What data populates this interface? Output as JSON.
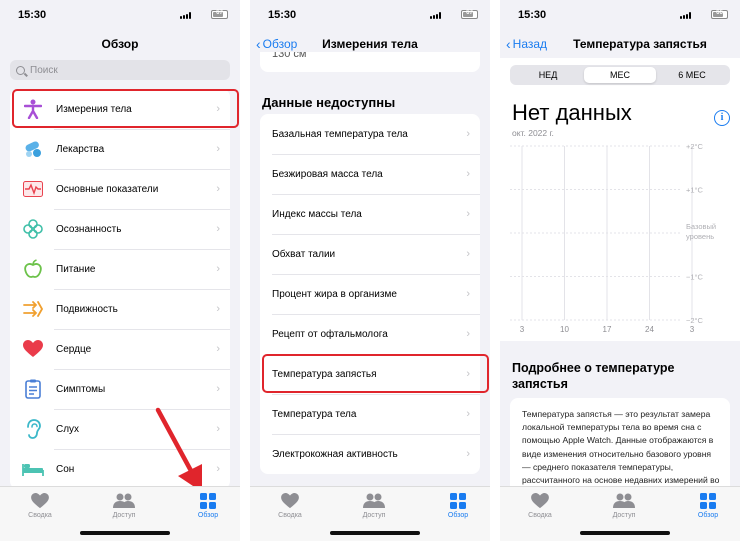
{
  "screens": [
    {
      "status": {
        "time": "15:30",
        "battery": "67"
      },
      "title": "Обзор",
      "search_placeholder": "Поиск",
      "items": [
        {
          "label": "Измерения тела",
          "icon": "body-measurements-icon"
        },
        {
          "label": "Лекарства",
          "icon": "medications-icon"
        },
        {
          "label": "Основные показатели",
          "icon": "vitals-icon"
        },
        {
          "label": "Осознанность",
          "icon": "mindfulness-icon"
        },
        {
          "label": "Питание",
          "icon": "nutrition-icon"
        },
        {
          "label": "Подвижность",
          "icon": "mobility-icon"
        },
        {
          "label": "Сердце",
          "icon": "heart-icon"
        },
        {
          "label": "Симптомы",
          "icon": "symptoms-icon"
        },
        {
          "label": "Слух",
          "icon": "hearing-icon"
        },
        {
          "label": "Сон",
          "icon": "sleep-icon"
        }
      ],
      "arrow": "›"
    },
    {
      "status": {
        "time": "15:30",
        "battery": "67"
      },
      "back": "Обзор",
      "title": "Измерения тела",
      "top_fragment": "130 см",
      "section": "Данные недоступны",
      "items": [
        "Базальная температура тела",
        "Безжировая масса тела",
        "Индекс массы тела",
        "Обхват талии",
        "Процент жира в организме",
        "Рецепт от офтальмолога",
        "Температура запястья",
        "Температура тела",
        "Электрокожная активность"
      ],
      "arrow": "›"
    },
    {
      "status": {
        "time": "15:30",
        "battery": "66"
      },
      "back": "Назад",
      "title": "Температура запястья",
      "segments": [
        "НЕД",
        "МЕС",
        "6 МЕС"
      ],
      "selected_segment": "МЕС",
      "no_data": "Нет данных",
      "period": "окт. 2022 г.",
      "info_glyph": "i",
      "chart_data": {
        "type": "line",
        "series": [],
        "x_ticks": [
          "3",
          "10",
          "17",
          "24",
          "3"
        ],
        "y_ticks": [
          "+2°C",
          "+1°C",
          "Базовый уровень",
          "−1°C",
          "−2°C"
        ],
        "ylim": [
          -2,
          2
        ],
        "grid": true
      },
      "about_title": "Подробнее о температуре запястья",
      "about_text": "Температура запястья — это результат замера локальной температуры тела во время сна с помощью Apple Watch. Данные отображаются в виде изменения относительно базового уровня — среднего показателя температуры, рассчитанного на основе недавних измерений во время сна."
    }
  ],
  "tabs": [
    {
      "label": "Сводка",
      "icon": "heart-icon"
    },
    {
      "label": "Доступ",
      "icon": "sharing-icon"
    },
    {
      "label": "Обзор",
      "icon": "browse-grid-icon"
    }
  ],
  "colors": {
    "accent": "#1a7cf0",
    "highlight": "#e0252c",
    "background": "#f2f2f7"
  }
}
